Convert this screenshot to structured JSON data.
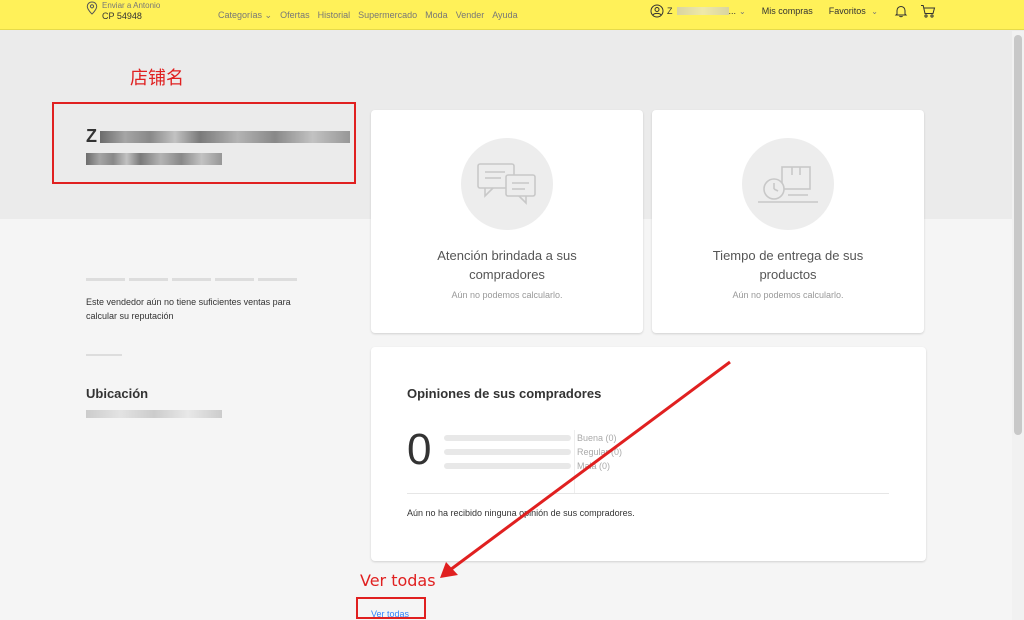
{
  "header": {
    "location_line1": "Enviar a Antonio",
    "location_line2": "CP 54948",
    "nav": [
      {
        "label": "Categorías",
        "dropdown": true
      },
      {
        "label": "Ofertas"
      },
      {
        "label": "Historial"
      },
      {
        "label": "Supermercado"
      },
      {
        "label": "Moda"
      },
      {
        "label": "Vender"
      },
      {
        "label": "Ayuda"
      }
    ],
    "user_initial": "Z",
    "user_suffix": "...",
    "my_purchases": "Mis compras",
    "favorites": "Favoritos",
    "bg_color": "#fff159"
  },
  "annotations": {
    "store_name_label": "店铺名",
    "ver_todas_label": "Ver todas",
    "color": "#e02020"
  },
  "store": {
    "name_visible_prefix": "Z"
  },
  "reputation": {
    "message": "Este vendedor aún no tiene suficientes ventas para calcular su reputación"
  },
  "location": {
    "title": "Ubicación"
  },
  "metrics": [
    {
      "icon": "chat-bubbles-icon",
      "title": "Atención brindada a sus compradores",
      "subtitle": "Aún no podemos calcularlo."
    },
    {
      "icon": "delivery-truck-icon",
      "title": "Tiempo de entrega de sus productos",
      "subtitle": "Aún no podemos calcularlo."
    }
  ],
  "opinions": {
    "title": "Opiniones de sus compradores",
    "count": "0",
    "ratings": [
      {
        "label": "Buena (0)"
      },
      {
        "label": "Regular (0)"
      },
      {
        "label": "Mala (0)"
      }
    ],
    "empty_message": "Aún no ha recibido ninguna opinión de sus compradores.",
    "see_all": "Ver todas"
  }
}
